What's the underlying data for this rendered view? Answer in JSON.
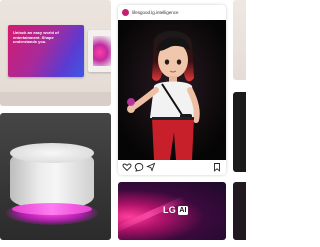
{
  "tv_panel": {
    "screen_text": "Unlock an easy world of entertainment. Shape understands you."
  },
  "post": {
    "handle": "lifesgood.lg.intelligence",
    "icons": [
      "heart-icon",
      "comment-icon",
      "share-icon",
      "bookmark-icon"
    ]
  },
  "lg_ai": {
    "brand": "LG",
    "badge": "AI"
  },
  "colors": {
    "accent_magenta": "#d41b6f",
    "accent_pink": "#ff4dd8",
    "dark_bg": "#070707"
  }
}
